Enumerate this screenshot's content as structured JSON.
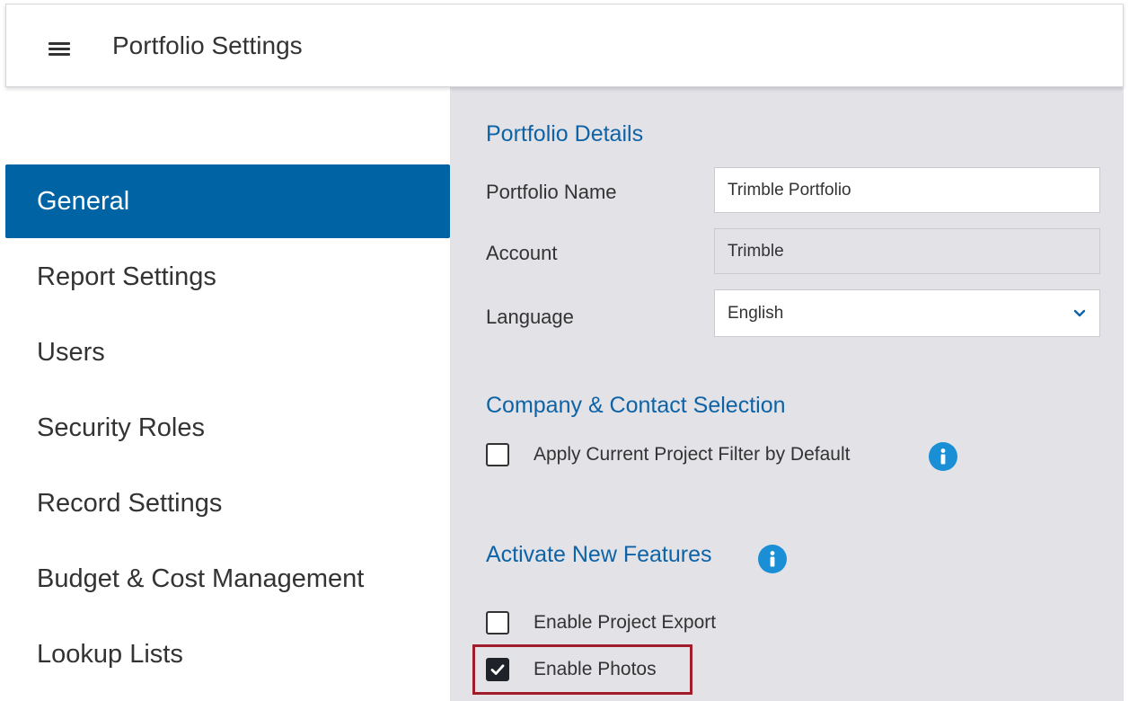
{
  "header": {
    "title": "Portfolio Settings",
    "menu_icon": "hamburger-menu-icon"
  },
  "sidebar": {
    "items": [
      {
        "label": "General",
        "active": true
      },
      {
        "label": "Report Settings"
      },
      {
        "label": "Users"
      },
      {
        "label": "Security Roles"
      },
      {
        "label": "Record Settings"
      },
      {
        "label": "Budget & Cost Management"
      },
      {
        "label": "Lookup Lists"
      }
    ]
  },
  "portfolio_details": {
    "title": "Portfolio Details",
    "name_label": "Portfolio Name",
    "name_value": "Trimble Portfolio",
    "account_label": "Account",
    "account_value": "Trimble",
    "language_label": "Language",
    "language_value": "English"
  },
  "company_contact": {
    "title": "Company & Contact Selection",
    "filter_label": "Apply Current Project Filter by Default",
    "filter_checked": false
  },
  "new_features": {
    "title": "Activate New Features",
    "export_label": "Enable Project Export",
    "export_checked": false,
    "photos_label": "Enable Photos",
    "photos_checked": true
  },
  "colors": {
    "accent": "#0063a3",
    "section_title": "#0e63a6",
    "info_icon": "#1a8fd6",
    "highlight": "#a11d2b",
    "main_bg": "#e2e2e7"
  }
}
